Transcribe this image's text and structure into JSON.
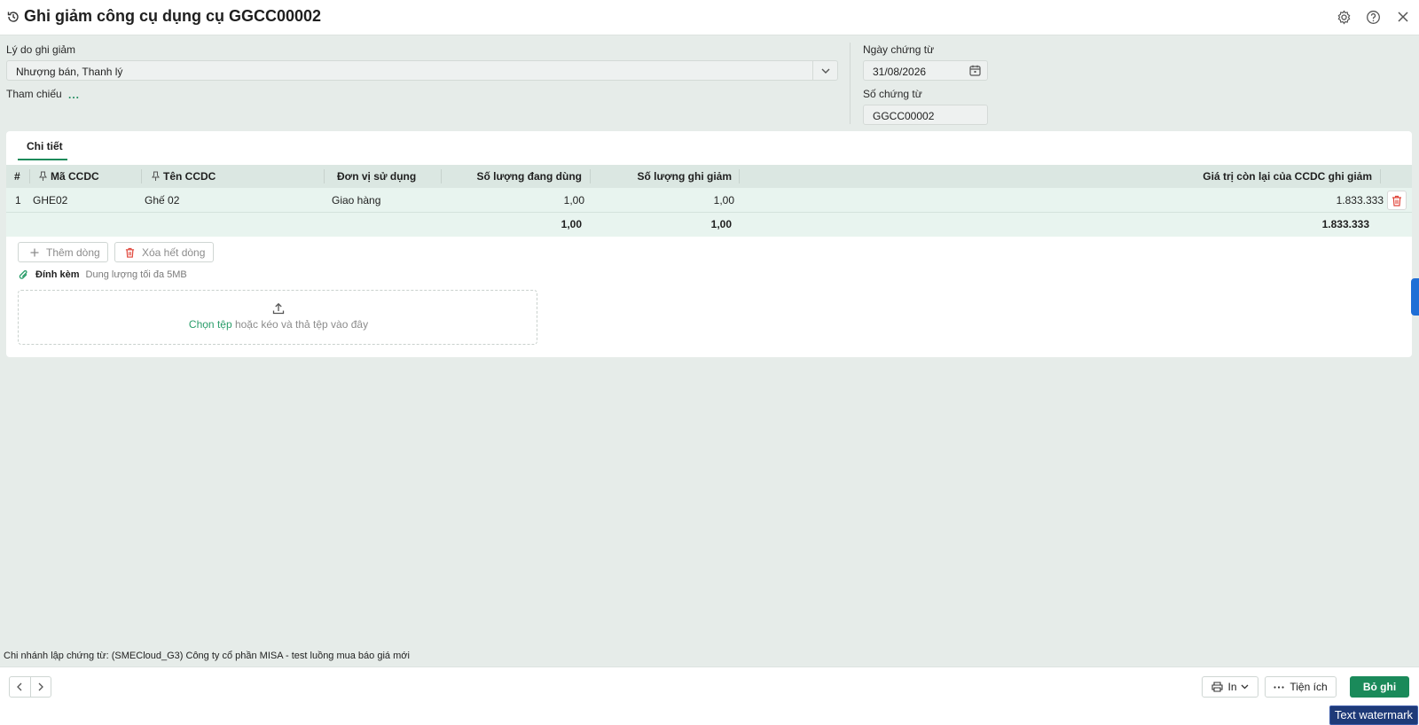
{
  "header": {
    "title": "Ghi giảm công cụ dụng cụ GGCC00002",
    "icons": [
      "history-icon",
      "settings-icon",
      "help-icon",
      "close-icon"
    ]
  },
  "form": {
    "reason_label": "Lý do ghi giảm",
    "reason_value": "Nhượng bán, Thanh lý",
    "reference_label": "Tham chiếu",
    "reference_link": "...",
    "date_label": "Ngày chứng từ",
    "date_value": "31/08/2026",
    "number_label": "Số chứng từ",
    "number_value": "GGCC00002"
  },
  "tabs": [
    {
      "label": "Chi tiết",
      "active": true
    }
  ],
  "table": {
    "headers": {
      "index": "#",
      "code": "Mã CCDC",
      "name": "Tên CCDC",
      "unit": "Đơn vị sử dụng",
      "qty_in_use": "Số lượng đang dùng",
      "qty_reduce": "Số lượng ghi giảm",
      "remaining_value": "Giá trị còn lại của CCDC ghi giảm"
    },
    "rows": [
      {
        "index": "1",
        "code": "GHE02",
        "name": "Ghế 02",
        "unit": "Giao hàng",
        "qty_in_use": "1,00",
        "qty_reduce": "1,00",
        "remaining_value": "1.833.333"
      }
    ],
    "totals": {
      "qty_in_use": "1,00",
      "qty_reduce": "1,00",
      "remaining_value": "1.833.333"
    },
    "add_row_label": "Thêm dòng",
    "clear_rows_label": "Xóa hết dòng"
  },
  "attachment": {
    "label": "Đính kèm",
    "limit": "Dung lượng tối đa 5MB",
    "choose_link": "Chọn tệp",
    "drop_text": " hoặc kéo và thả tệp vào đây"
  },
  "branch_text": "Chi nhánh lập chứng từ: (SMECloud_G3) Công ty cổ phần MISA - test luồng mua báo giá mới",
  "footer": {
    "print_label": "In",
    "utilities_label": "Tiện ích",
    "unpost_label": "Bỏ ghi"
  },
  "watermark": "Text watermark",
  "colors": {
    "primary": "#1a8a5a",
    "page_bg": "#e6ece9",
    "table_header_bg": "#dbe7e2",
    "row_bg": "#e8f4ef",
    "danger": "#e0453a"
  }
}
